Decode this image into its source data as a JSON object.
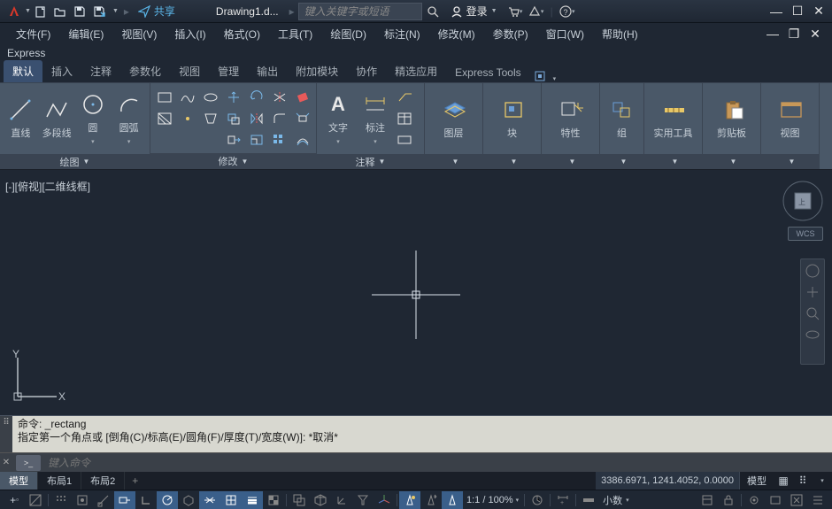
{
  "titlebar": {
    "share": "共享",
    "doc": "Drawing1.d...",
    "search_placeholder": "键入关键字或短语",
    "login": "登录"
  },
  "menus": [
    "文件(F)",
    "编辑(E)",
    "视图(V)",
    "插入(I)",
    "格式(O)",
    "工具(T)",
    "绘图(D)",
    "标注(N)",
    "修改(M)",
    "参数(P)",
    "窗口(W)",
    "帮助(H)"
  ],
  "express": "Express",
  "ribbon_tabs": [
    "默认",
    "插入",
    "注释",
    "参数化",
    "视图",
    "管理",
    "输出",
    "附加模块",
    "协作",
    "精选应用",
    "Express Tools"
  ],
  "ribbon": {
    "panel_draw": {
      "title": "绘图",
      "labels": [
        "直线",
        "多段线",
        "圆",
        "圆弧"
      ]
    },
    "panel_modify": {
      "title": "修改"
    },
    "panel_annot": {
      "title": "注释",
      "labels": [
        "文字",
        "标注"
      ]
    },
    "panel_layer": {
      "title": "图层"
    },
    "panel_block": {
      "title": "块"
    },
    "panel_props": {
      "title": "特性"
    },
    "panel_group": {
      "title": "组"
    },
    "panel_util": {
      "title": "实用工具"
    },
    "panel_clip": {
      "title": "剪贴板"
    },
    "panel_view": {
      "title": "视图"
    }
  },
  "canvas": {
    "view_label": "[-][俯视][二维线框]",
    "wcs": "WCS"
  },
  "cmd": {
    "line1": "命令: _rectang",
    "line2": "指定第一个角点或 [倒角(C)/标高(E)/圆角(F)/厚度(T)/宽度(W)]: *取消*",
    "placeholder": "键入命令",
    "prompt_icon": ">_"
  },
  "layout": {
    "tabs": [
      "模型",
      "布局1",
      "布局2"
    ],
    "coords": "3386.6971, 1241.4052, 0.0000",
    "mode": "模型"
  },
  "status": {
    "scale": "1:1 / 100%",
    "units": "小数"
  }
}
